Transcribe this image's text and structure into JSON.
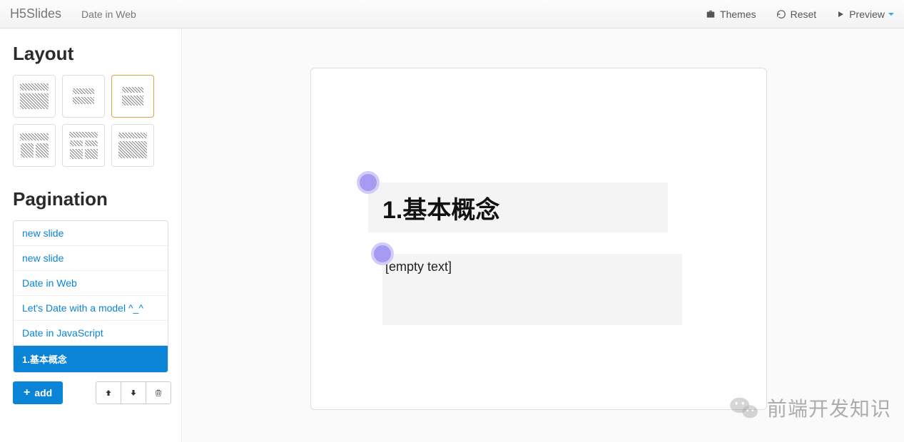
{
  "navbar": {
    "brand": "H5Slides",
    "subtitle": "Date in Web",
    "themes": "Themes",
    "reset": "Reset",
    "preview": "Preview"
  },
  "sidebar": {
    "layout_title": "Layout",
    "pagination_title": "Pagination",
    "pages": [
      {
        "label": "new slide",
        "active": false
      },
      {
        "label": "new slide",
        "active": false
      },
      {
        "label": "Date in Web",
        "active": false
      },
      {
        "label": "Let's Date with a model ^_^",
        "active": false
      },
      {
        "label": "Date in JavaScript",
        "active": false
      },
      {
        "label": "1.基本概念",
        "active": true
      }
    ],
    "add_label": "add"
  },
  "slide": {
    "title_text": "1.基本概念",
    "body_text": "[empty text]"
  },
  "watermark": {
    "text": "前端开发知识"
  }
}
